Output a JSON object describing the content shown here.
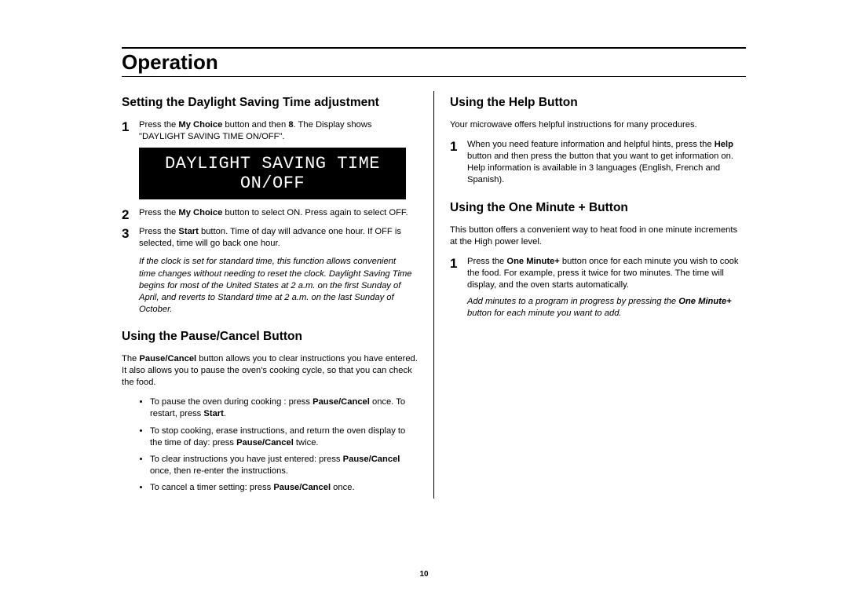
{
  "page_title": "Operation",
  "page_number": "10",
  "left": {
    "section1": {
      "title": "Setting the Daylight Saving Time adjustment",
      "step1_a": "Press the ",
      "step1_b": "My Choice",
      "step1_c": " button and then ",
      "step1_d": "8",
      "step1_e": ". The Display shows \"DAYLIGHT SAVING TIME ON/OFF\".",
      "display": "DAYLIGHT SAVING TIME ON/OFF",
      "step2_a": "Press the ",
      "step2_b": "My Choice",
      "step2_c": " button to select ON. Press again to select OFF.",
      "step3_a": "Press the ",
      "step3_b": "Start",
      "step3_c": " button. Time of day will advance one hour. If OFF is selected, time will go back one hour.",
      "note": "If the clock is set for standard time, this function allows convenient time changes without needing to reset the clock. Daylight Saving Time begins for most of the United States at 2 a.m. on the first Sunday of April, and reverts to Standard time at 2 a.m. on the last Sunday of October."
    },
    "section2": {
      "title": "Using the Pause/Cancel Button",
      "intro_a": "The ",
      "intro_b": "Pause/Cancel",
      "intro_c": " button allows you to clear instructions you have entered. It also allows you to pause the oven's cooking cycle, so that you can check the food.",
      "b1_a": "To pause the oven during cooking : press ",
      "b1_b": "Pause/Cancel",
      "b1_c": " once. To restart, press ",
      "b1_d": "Start",
      "b1_e": ".",
      "b2_a": "To stop cooking, erase instructions, and return the oven display to the time of day: press ",
      "b2_b": "Pause/Cancel",
      "b2_c": " twice.",
      "b3_a": "To clear instructions you have just entered: press ",
      "b3_b": "Pause/Cancel",
      "b3_c": " once, then re-enter the instructions.",
      "b4_a": "To cancel a timer setting: press ",
      "b4_b": "Pause/Cancel",
      "b4_c": " once."
    }
  },
  "right": {
    "section1": {
      "title": "Using the Help Button",
      "intro": "Your microwave offers helpful instructions for many procedures.",
      "step1_a": "When you need feature information and helpful hints, press the ",
      "step1_b": "Help",
      "step1_c": " button and then press the button that you want to get information on. Help information is available in 3 languages (English, French and Spanish)."
    },
    "section2": {
      "title": "Using the One Minute + Button",
      "intro": "This button offers a convenient way to heat food in one minute increments at the High power level.",
      "step1_a": "Press the ",
      "step1_b": "One Minute+",
      "step1_c": " button once for each minute you wish to cook the food. For example, press it twice for two minutes. The time will display, and the oven starts automatically.",
      "note_a": "Add minutes to a program in progress by pressing the ",
      "note_b": "One Minute+",
      "note_c": " button for each minute you want to add."
    }
  }
}
